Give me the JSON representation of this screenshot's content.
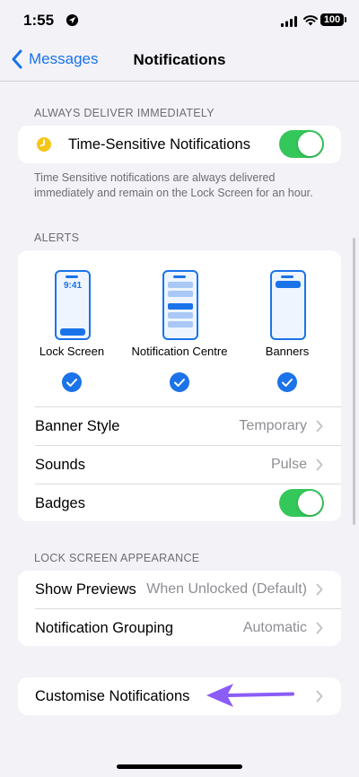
{
  "status_bar": {
    "time": "1:55",
    "battery": "100"
  },
  "nav": {
    "back_label": "Messages",
    "title": "Notifications"
  },
  "section_always": {
    "header": "ALWAYS DELIVER IMMEDIATELY",
    "time_sensitive_label": "Time-Sensitive Notifications",
    "time_sensitive_on": true,
    "footer": "Time Sensitive notifications are always delivered immediately and remain on the Lock Screen for an hour."
  },
  "section_alerts": {
    "header": "ALERTS",
    "styles": [
      {
        "caption": "Lock Screen",
        "preview_time": "9:41",
        "checked": true
      },
      {
        "caption": "Notification Centre",
        "checked": true
      },
      {
        "caption": "Banners",
        "checked": true
      }
    ],
    "banner_style": {
      "label": "Banner Style",
      "value": "Temporary"
    },
    "sounds": {
      "label": "Sounds",
      "value": "Pulse"
    },
    "badges": {
      "label": "Badges",
      "on": true
    }
  },
  "section_lock_screen": {
    "header": "LOCK SCREEN APPEARANCE",
    "show_previews": {
      "label": "Show Previews",
      "value": "When Unlocked (Default)"
    },
    "notification_grouping": {
      "label": "Notification Grouping",
      "value": "Automatic"
    }
  },
  "customise": {
    "label": "Customise Notifications"
  },
  "colors": {
    "accent": "#1a73e8",
    "toggle_on": "#34c759",
    "annotation_arrow": "#8b5cf6"
  }
}
